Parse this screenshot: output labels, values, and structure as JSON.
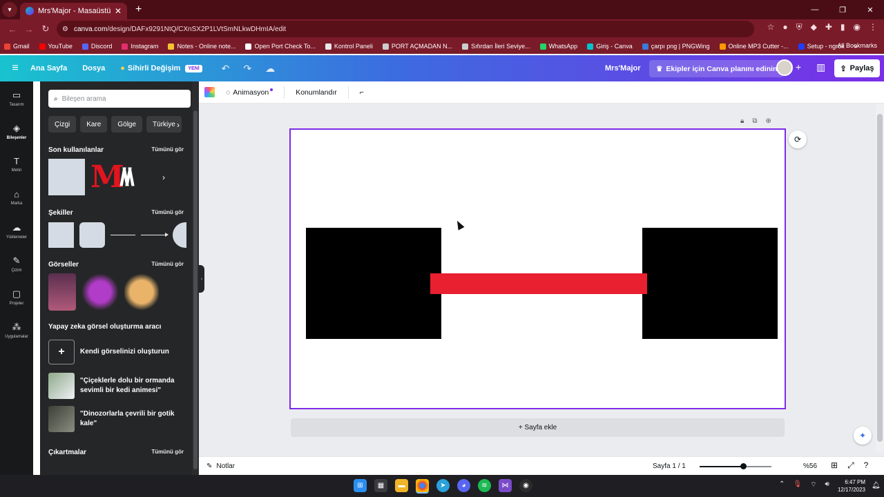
{
  "browser": {
    "tab_title": "Mrs'Major - Masaüstü Duvar K",
    "url_domain": "canva.com",
    "url_path": "/design/DAFx9291NtQ/CXnSX2P1LVtSmNLkwDHmIA/edit",
    "bookmarks": [
      {
        "label": "Gmail",
        "color": "#ea4335"
      },
      {
        "label": "YouTube",
        "color": "#ff0000"
      },
      {
        "label": "Discord",
        "color": "#5865f2"
      },
      {
        "label": "Instagram",
        "color": "#e1306c"
      },
      {
        "label": "Notes - Online note...",
        "color": "#f4c430"
      },
      {
        "label": "Open Port Check To...",
        "color": "#ffffff"
      },
      {
        "label": "Kontrol Paneli",
        "color": "#e8e8e8"
      },
      {
        "label": "PORT AÇMADAN N...",
        "color": "#cccccc"
      },
      {
        "label": "Sıfırdan İleri Seviye...",
        "color": "#cccccc"
      },
      {
        "label": "WhatsApp",
        "color": "#25d366"
      },
      {
        "label": "Giriş - Canva",
        "color": "#00c4cc"
      },
      {
        "label": "çarpı png | PNGWing",
        "color": "#3a7bd5"
      },
      {
        "label": "Online MP3 Cutter -...",
        "color": "#ff9800"
      },
      {
        "label": "Setup - ngrok",
        "color": "#1f3fff"
      }
    ],
    "all_bookmarks": "All Bookmarks"
  },
  "header": {
    "home": "Ana Sayfa",
    "file": "Dosya",
    "magic": "Sihirli Değişim",
    "new_badge": "YENİ",
    "user": "Mrs'Major",
    "teams_cta": "Ekipler için Canva planını edinin",
    "share": "Paylaş"
  },
  "rail": [
    {
      "label": "Tasarım",
      "icon": "▭"
    },
    {
      "label": "Bileşenler",
      "icon": "◈"
    },
    {
      "label": "Metin",
      "icon": "T"
    },
    {
      "label": "Marka",
      "icon": "⌂"
    },
    {
      "label": "Yüklemeler",
      "icon": "☁"
    },
    {
      "label": "Çizim",
      "icon": "✎"
    },
    {
      "label": "Projeler",
      "icon": "▢"
    },
    {
      "label": "Uygulamalar",
      "icon": "⁂"
    }
  ],
  "panel": {
    "search_placeholder": "Bileşen arama",
    "chips": [
      "Çizgi",
      "Kare",
      "Gölge",
      "Türkiye"
    ],
    "see_all": "Tümünü gör",
    "recent_title": "Son kullanılanlar",
    "shapes_title": "Şekiller",
    "graphics_title": "Görseller",
    "ai_title": "Yapay zeka görsel oluşturma aracı",
    "ai_create": "Kendi görselinizi oluşturun",
    "ai_prompt_1_line1": "\"Çiçeklerle dolu bir ormanda",
    "ai_prompt_1_line2": "sevimli bir kedi animesi\"",
    "ai_prompt_2_line1": "\"Dinozorlarla çevrili bir gotik",
    "ai_prompt_2_line2": "kale\"",
    "stickers_title": "Çıkartmalar"
  },
  "toolbar": {
    "animation": "Animasyon",
    "position": "Konumlandır"
  },
  "canvas": {
    "add_page": "+ Sayfa ekle",
    "page_bg": "#ffffff",
    "shape_colors": {
      "black": "#000000",
      "red": "#e8202f"
    }
  },
  "footer": {
    "notes": "Notlar",
    "page_count": "Sayfa 1 / 1",
    "zoom": "%56",
    "zoom_level": 0.56
  },
  "taskbar": {
    "time": "6:47 PM",
    "date": "12/17/2023"
  }
}
